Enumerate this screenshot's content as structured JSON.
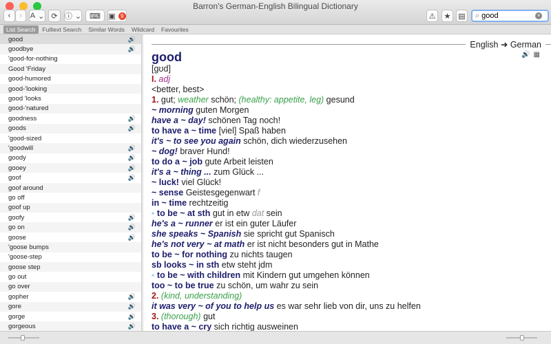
{
  "window": {
    "title": "Barron's German-English Bilingual Dictionary"
  },
  "toolbar": {
    "back": "‹",
    "forward": "›",
    "font": "A",
    "font_chevron": "⌄",
    "refresh": "⟳",
    "info": "ⓘ",
    "info_chevron": "⌄",
    "keyboard": "⌨",
    "badge": "9",
    "warning": "⚠",
    "star": "★",
    "panel": "▤"
  },
  "search": {
    "value": "good",
    "clear": "×",
    "icon": "⌕"
  },
  "tabs": [
    "List Search",
    "Fulltext Search",
    "Similar Words",
    "Wildcard",
    "Favourites"
  ],
  "list": [
    {
      "w": "good",
      "s": true
    },
    {
      "w": "goodbye",
      "s": true
    },
    {
      "w": "'good-for-nothing",
      "s": false
    },
    {
      "w": "Good 'Friday",
      "s": false
    },
    {
      "w": "good-humored",
      "s": false
    },
    {
      "w": "good-'looking",
      "s": false
    },
    {
      "w": "good 'looks",
      "s": false
    },
    {
      "w": "good-'natured",
      "s": false
    },
    {
      "w": "goodness",
      "s": true
    },
    {
      "w": "goods",
      "s": true
    },
    {
      "w": "'good-sized",
      "s": false
    },
    {
      "w": "'goodwill",
      "s": true
    },
    {
      "w": "goody",
      "s": true
    },
    {
      "w": "gooey",
      "s": true
    },
    {
      "w": "goof",
      "s": true
    },
    {
      "w": "goof around",
      "s": false
    },
    {
      "w": "go off",
      "s": false
    },
    {
      "w": "goof up",
      "s": false
    },
    {
      "w": "goofy",
      "s": true
    },
    {
      "w": "go on",
      "s": true
    },
    {
      "w": "goose",
      "s": true
    },
    {
      "w": "'goose bumps",
      "s": false
    },
    {
      "w": "'goose-step",
      "s": false
    },
    {
      "w": "goose step",
      "s": false
    },
    {
      "w": "go out",
      "s": false
    },
    {
      "w": "go over",
      "s": false
    },
    {
      "w": "gopher",
      "s": true
    },
    {
      "w": "gore",
      "s": true
    },
    {
      "w": "gorge",
      "s": true
    },
    {
      "w": "gorgeous",
      "s": true
    }
  ],
  "direction": "English ➜ German",
  "entry": {
    "headword": "good",
    "lines": [
      [
        [
          "t",
          "[gʊd]"
        ]
      ],
      [
        [
          "n",
          "I. "
        ],
        [
          "pos",
          "adj"
        ]
      ],
      [
        [
          "t",
          "<better, best>"
        ]
      ],
      [
        [
          "n",
          "1. "
        ],
        [
          "t",
          "gut; "
        ],
        [
          "g",
          "weather"
        ],
        [
          "t",
          " schön; "
        ],
        [
          "g",
          "(healthy: appetite, leg)"
        ],
        [
          "t",
          " gesund"
        ]
      ],
      [
        [
          "hi",
          "~ morning"
        ],
        [
          "t",
          " guten Morgen"
        ]
      ],
      [
        [
          "hi",
          "have a ~ day!"
        ],
        [
          "t",
          " schönen Tag noch!"
        ]
      ],
      [
        [
          "h",
          "to have a ~ time"
        ],
        [
          "t",
          " [viel] Spaß haben"
        ]
      ],
      [
        [
          "hi",
          "it's ~ to see you again"
        ],
        [
          "t",
          " schön, dich wiederzusehen"
        ]
      ],
      [
        [
          "hi",
          "~ dog!"
        ],
        [
          "t",
          " braver Hund!"
        ]
      ],
      [
        [
          "h",
          "to do a ~ job"
        ],
        [
          "t",
          " gute Arbeit leisten"
        ]
      ],
      [
        [
          "hi",
          "it's a ~ thing ..."
        ],
        [
          "t",
          " zum Glück ..."
        ]
      ],
      [
        [
          "h",
          "~ luck!"
        ],
        [
          "t",
          " viel Glück!"
        ]
      ],
      [
        [
          "h",
          "~ sense"
        ],
        [
          "t",
          " Geistesgegenwart "
        ],
        [
          "gr",
          "f"
        ]
      ],
      [
        [
          "h",
          "in ~ time"
        ],
        [
          "t",
          " rechtzeitig"
        ]
      ],
      [
        [
          "b",
          "▪ "
        ],
        [
          "h",
          "to be ~ at sth"
        ],
        [
          "t",
          " gut in etw "
        ],
        [
          "gr",
          "dat"
        ],
        [
          "t",
          " sein"
        ]
      ],
      [
        [
          "hi",
          "he's a ~ runner"
        ],
        [
          "t",
          " er ist ein guter Läufer"
        ]
      ],
      [
        [
          "hi",
          "she speaks ~ Spanish"
        ],
        [
          "t",
          " sie spricht gut Spanisch"
        ]
      ],
      [
        [
          "hi",
          "he's not very ~ at math"
        ],
        [
          "t",
          " er ist nicht besonders gut in Mathe"
        ]
      ],
      [
        [
          "h",
          "to be ~ for nothing"
        ],
        [
          "t",
          " zu nichts taugen"
        ]
      ],
      [
        [
          "h",
          "sb looks ~ in sth"
        ],
        [
          "t",
          " etw steht jdm"
        ]
      ],
      [
        [
          "b",
          "▪ "
        ],
        [
          "h",
          "to be ~ with children"
        ],
        [
          "t",
          " mit Kindern gut umgehen können"
        ]
      ],
      [
        [
          "h",
          "too ~ to be true"
        ],
        [
          "t",
          " zu schön, um wahr zu sein"
        ]
      ],
      [
        [
          "n",
          "2. "
        ],
        [
          "g",
          "(kind, understanding)"
        ]
      ],
      [
        [
          "hi",
          "it was very ~ of you to help us"
        ],
        [
          "t",
          " es war sehr lieb von dir, uns zu helfen"
        ]
      ],
      [
        [
          "n",
          "3. "
        ],
        [
          "g",
          "(thorough)"
        ],
        [
          "t",
          " gut"
        ]
      ],
      [
        [
          "h",
          "to have a ~ cry"
        ],
        [
          "t",
          " sich richtig ausweinen"
        ]
      ]
    ]
  },
  "entry_icons": {
    "speaker": "🔊",
    "table": "▦"
  },
  "colors": {
    "headword": "#1d1d6b",
    "gloss": "#3aa04a",
    "number": "#a01818"
  }
}
